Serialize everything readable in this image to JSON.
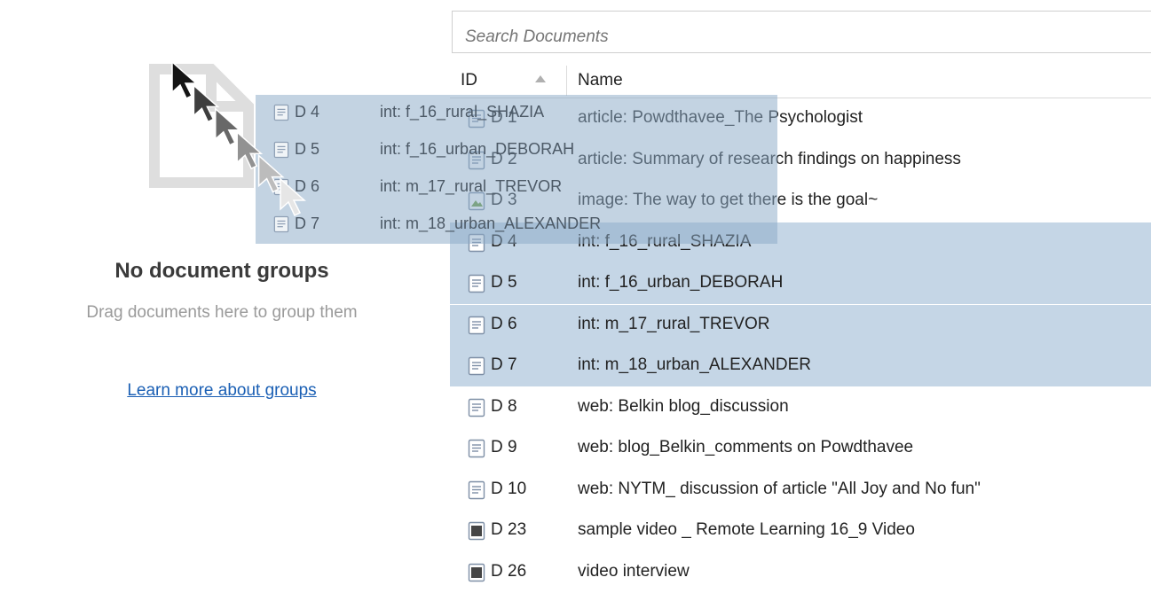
{
  "groups": {
    "empty_title": "No document groups",
    "empty_hint": "Drag documents here to group them",
    "learn_more_link": "Learn more about groups",
    "placeholder_icon": "empty-group-icon"
  },
  "search": {
    "placeholder": "Search Documents",
    "value": ""
  },
  "table": {
    "columns": [
      "ID",
      "Name"
    ],
    "sort": {
      "column": "ID",
      "direction": "ascending"
    },
    "rows": [
      {
        "id": "D 1",
        "name": "article: Powdthavee_The Psychologist",
        "icon": "text-document-icon",
        "selected": false
      },
      {
        "id": "D 2",
        "name": "article: Summary of research findings on happiness",
        "icon": "text-document-icon",
        "selected": false
      },
      {
        "id": "D 3",
        "name": "image: The way to get there is the goal~",
        "icon": "image-document-icon",
        "selected": false
      },
      {
        "id": "D 4",
        "name": "int: f_16_rural_SHAZIA",
        "icon": "text-document-icon",
        "selected": true
      },
      {
        "id": "D 5",
        "name": "int: f_16_urban_DEBORAH",
        "icon": "text-document-icon",
        "selected": true
      },
      {
        "id": "D 6",
        "name": "int: m_17_rural_TREVOR",
        "icon": "text-document-icon",
        "selected": true
      },
      {
        "id": "D 7",
        "name": "int: m_18_urban_ALEXANDER",
        "icon": "text-document-icon",
        "selected": true
      },
      {
        "id": "D 8",
        "name": "web: Belkin blog_discussion",
        "icon": "text-document-icon",
        "selected": false
      },
      {
        "id": "D 9",
        "name": "web: blog_Belkin_comments on Powdthavee",
        "icon": "text-document-icon",
        "selected": false
      },
      {
        "id": "D 10",
        "name": "web: NYTM_ discussion of article \"All Joy and No fun\"",
        "icon": "text-document-icon",
        "selected": false
      },
      {
        "id": "D 23",
        "name": "sample video _ Remote Learning 16_9 Video",
        "icon": "video-document-icon",
        "selected": false
      },
      {
        "id": "D 26",
        "name": "video interview",
        "icon": "video-document-icon",
        "selected": false
      }
    ]
  },
  "drag_ghost": {
    "rows": [
      {
        "id": "D 4",
        "name": "int: f_16_rural_SHAZIA"
      },
      {
        "id": "D 5",
        "name": "int: f_16_urban_DEBORAH"
      },
      {
        "id": "D 6",
        "name": "int: m_17_rural_TREVOR"
      },
      {
        "id": "D 7",
        "name": "int: m_18_urban_ALEXANDER"
      }
    ]
  },
  "cursor": {
    "icon": "drag-cursor-icon"
  },
  "colors": {
    "selection": "#c5d6e6",
    "link": "#1a5fb4",
    "ghost": "#8caac8"
  }
}
